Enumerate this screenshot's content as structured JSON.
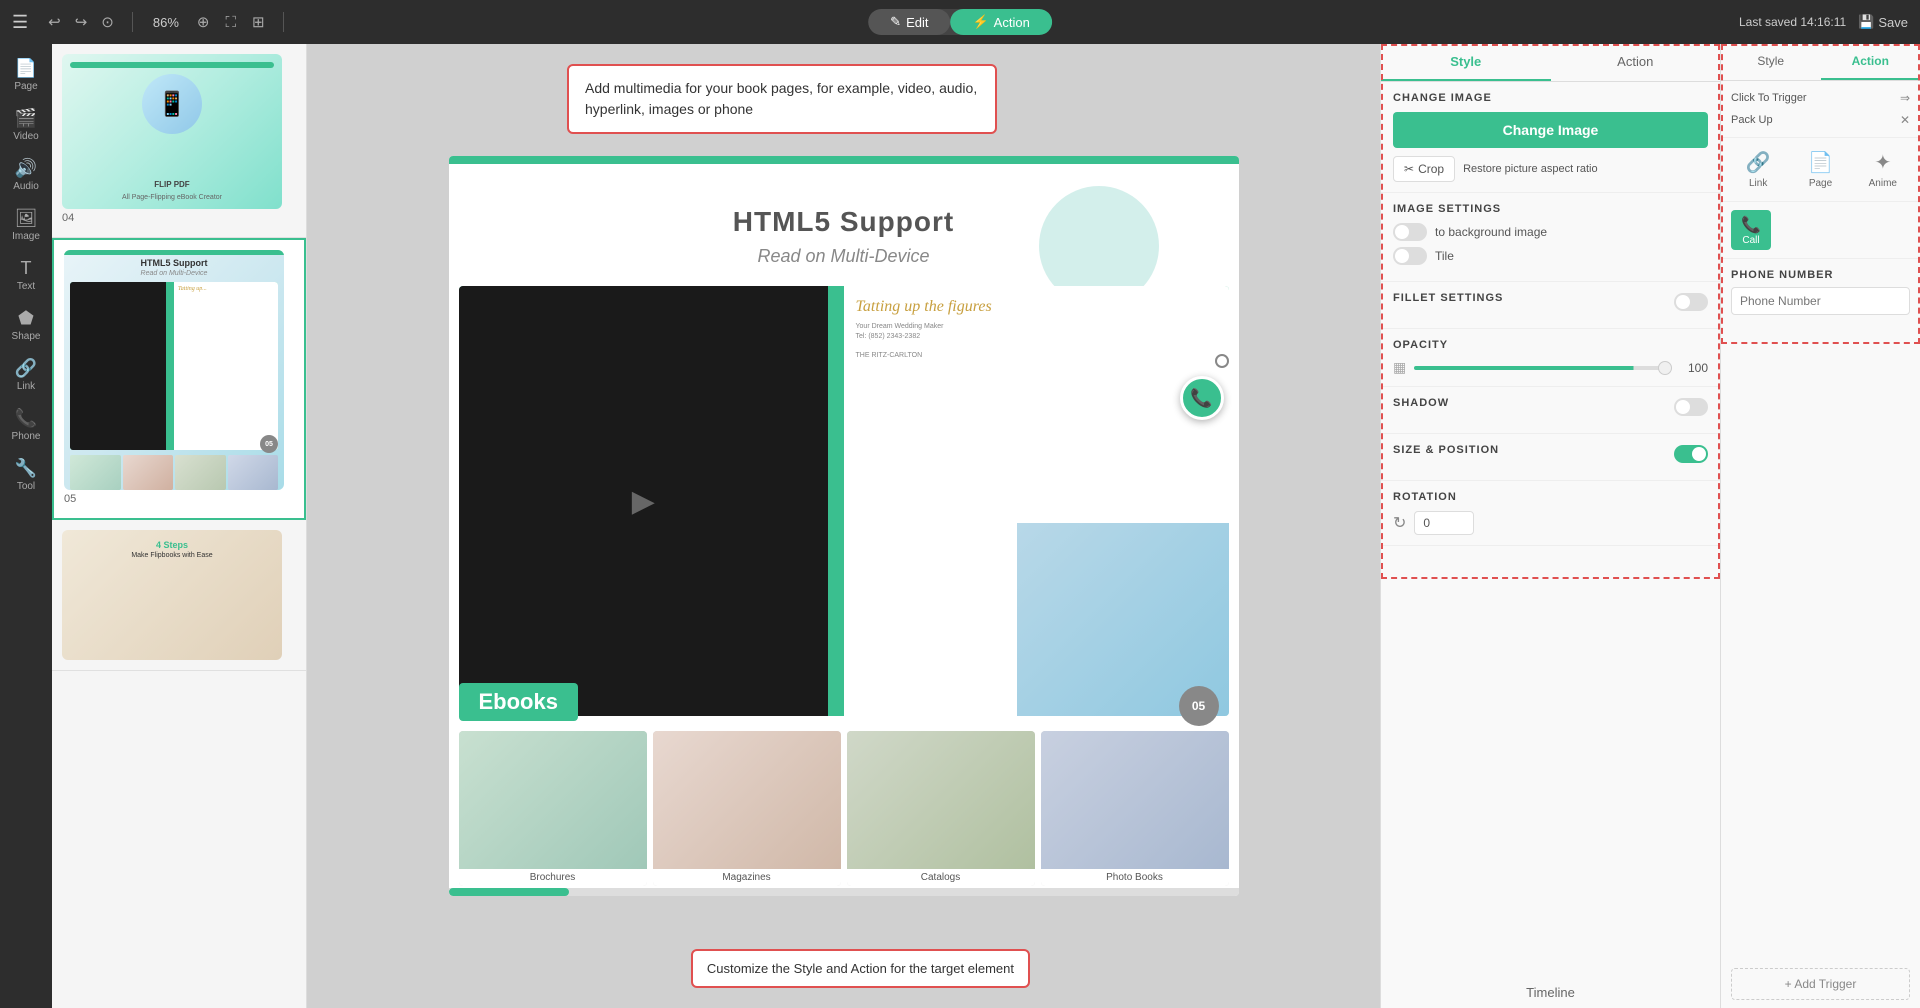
{
  "topbar": {
    "menu_icon": "☰",
    "undo_icon": "↩",
    "redo_icon": "↪",
    "save_state_icon": "⊙",
    "zoom_level": "86%",
    "zoom_icon": "⊕",
    "fullscreen_icon": "⛶",
    "layout_icon": "⊞",
    "edit_tab": "Edit",
    "action_tab": "Action",
    "last_saved_label": "Last saved 14:16:11",
    "save_label": "Save",
    "edit_icon": "✎",
    "action_icon": "⚡"
  },
  "sidebar": {
    "items": [
      {
        "icon": "📄",
        "label": "Page"
      },
      {
        "icon": "🎬",
        "label": "Video"
      },
      {
        "icon": "🔊",
        "label": "Audio"
      },
      {
        "icon": "🖼",
        "label": "Image"
      },
      {
        "icon": "T",
        "label": "Text"
      },
      {
        "icon": "⬟",
        "label": "Shape"
      },
      {
        "icon": "🔗",
        "label": "Link"
      },
      {
        "icon": "📞",
        "label": "Phone"
      },
      {
        "icon": "🔧",
        "label": "Tool"
      }
    ]
  },
  "canvas": {
    "page_title": "HTML5 Support",
    "page_subtitle": "Read on Multi-Device",
    "ebooks_label": "Ebooks",
    "page_num": "05",
    "grid_items": [
      {
        "label": "Brochures"
      },
      {
        "label": "Magazines"
      },
      {
        "label": "Catalogs"
      },
      {
        "label": "Photo Books"
      }
    ]
  },
  "tooltip1": {
    "text": "Add multimedia for your book pages, for example, video, audio, hyperlink, images or phone"
  },
  "tooltip2": {
    "text": "Customize the Style and Action for the target element"
  },
  "pages_panel": {
    "page4_num": "04",
    "page5_num": "05"
  },
  "right_panel": {
    "style_tab": "Style",
    "action_tab": "Action",
    "change_image_section": "CHANGE IMAGE",
    "change_image_btn": "Change Image",
    "crop_btn": "Crop",
    "restore_btn": "Restore picture aspect ratio",
    "image_settings_section": "IMAGE SETTINGS",
    "to_background_label": "to background image",
    "tile_label": "Tile",
    "fillet_settings_section": "FILLET SETTINGS",
    "opacity_section": "OPACITY",
    "opacity_value": "100",
    "shadow_section": "SHADOW",
    "size_position_section": "SIZE & POSITION",
    "rotation_section": "ROTATION",
    "rotation_value": "0",
    "timeline_btn": "Timeline"
  },
  "far_right_panel": {
    "style_tab": "Style",
    "action_tab": "Action",
    "click_trigger_label": "Click To Trigger",
    "pack_up_label": "Pack Up",
    "link_icon": "🔗",
    "link_label": "Link",
    "page_icon": "📄",
    "page_label": "Page",
    "anime_icon": "✦",
    "anime_label": "Anime",
    "call_icon": "📞",
    "call_label": "Call",
    "phone_section_title": "PHONE NUMBER",
    "phone_placeholder": "Phone Number",
    "add_trigger_btn": "+ Add Trigger"
  }
}
